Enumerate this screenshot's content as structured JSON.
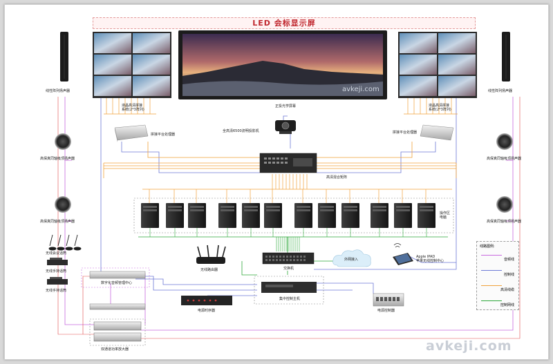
{
  "banner": {
    "title": "LED  会标显示屏"
  },
  "watermark": {
    "main": "avkeji.com",
    "screen": "avkeji.com"
  },
  "labels": {
    "speaker_line_left": "线性阵列扬声器",
    "speaker_line_right": "线性阵列扬声器",
    "ceiling_left_1": "高保真同轴吸顶扬声器",
    "ceiling_left_2": "高保真同轴吸顶扬声器",
    "ceiling_right_1": "高保真同轴吸顶扬声器",
    "ceiling_right_2": "高保真同轴吸顶扬声器",
    "splice_wall_left": "液晶高清拼接\n系统(2*3阵列)",
    "splice_wall_right": "液晶高清拼接\n系统(2*3阵列)",
    "splice_ctrl_left": "拼接平台处理器",
    "splice_ctrl_right": "拼接平台处理器",
    "projector_screen": "正投光学屏幕",
    "projector": "全高清6500流明投影机",
    "matrix": "高清混合矩阵",
    "workstation": "操作区\n电脑",
    "wifi_router": "无线路由器",
    "switch": "交换机",
    "internet": "外网接入",
    "ipad": "Apple IPAD\n苹果无线控制中心",
    "mic_conf": "无线会议话筒",
    "mic_handheld_1": "无线手持话筒",
    "mic_handheld_2": "无线手持话筒",
    "audio_center": "数字化音频管理中心",
    "power_seq": "电源时序器",
    "central_ctrl": "集中控制主机",
    "power_ctrl": "电源控制器",
    "amplifier": "双通道功率放大器"
  },
  "legend": {
    "title": "线路图例:",
    "items": [
      {
        "label": "音频线",
        "color": "#c86adf"
      },
      {
        "label": "控制线",
        "color": "#6d79d6"
      },
      {
        "label": "高清线缆",
        "color": "#f0a23a"
      },
      {
        "label": "控制网线",
        "color": "#2ea83a"
      }
    ]
  },
  "colors": {
    "audio": "#c86adf",
    "control": "#6d79d6",
    "video": "#f0a23a",
    "network": "#2ea83a",
    "red": "#e24a4a"
  }
}
